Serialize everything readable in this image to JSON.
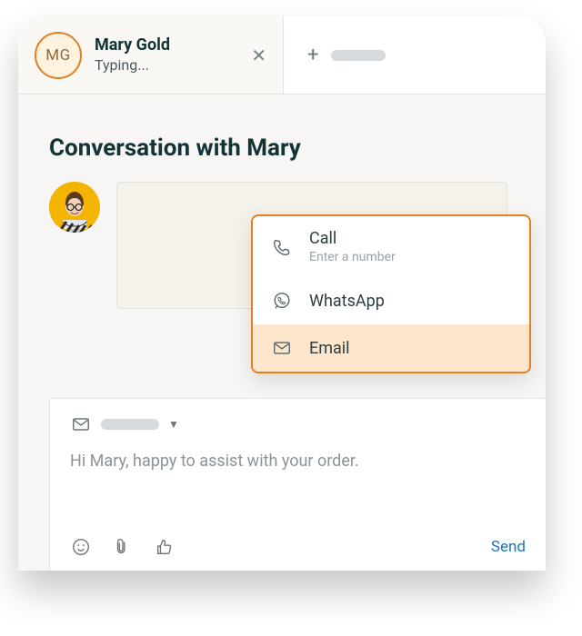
{
  "tab": {
    "initials": "MG",
    "title": "Mary Gold",
    "subtitle": "Typing..."
  },
  "heading": "Conversation with Mary",
  "composer": {
    "body": "Hi Mary, happy to assist with your order.",
    "send_label": "Send"
  },
  "channel_menu": {
    "call_label": "Call",
    "call_sub": "Enter a number",
    "whatsapp_label": "WhatsApp",
    "email_label": "Email"
  }
}
